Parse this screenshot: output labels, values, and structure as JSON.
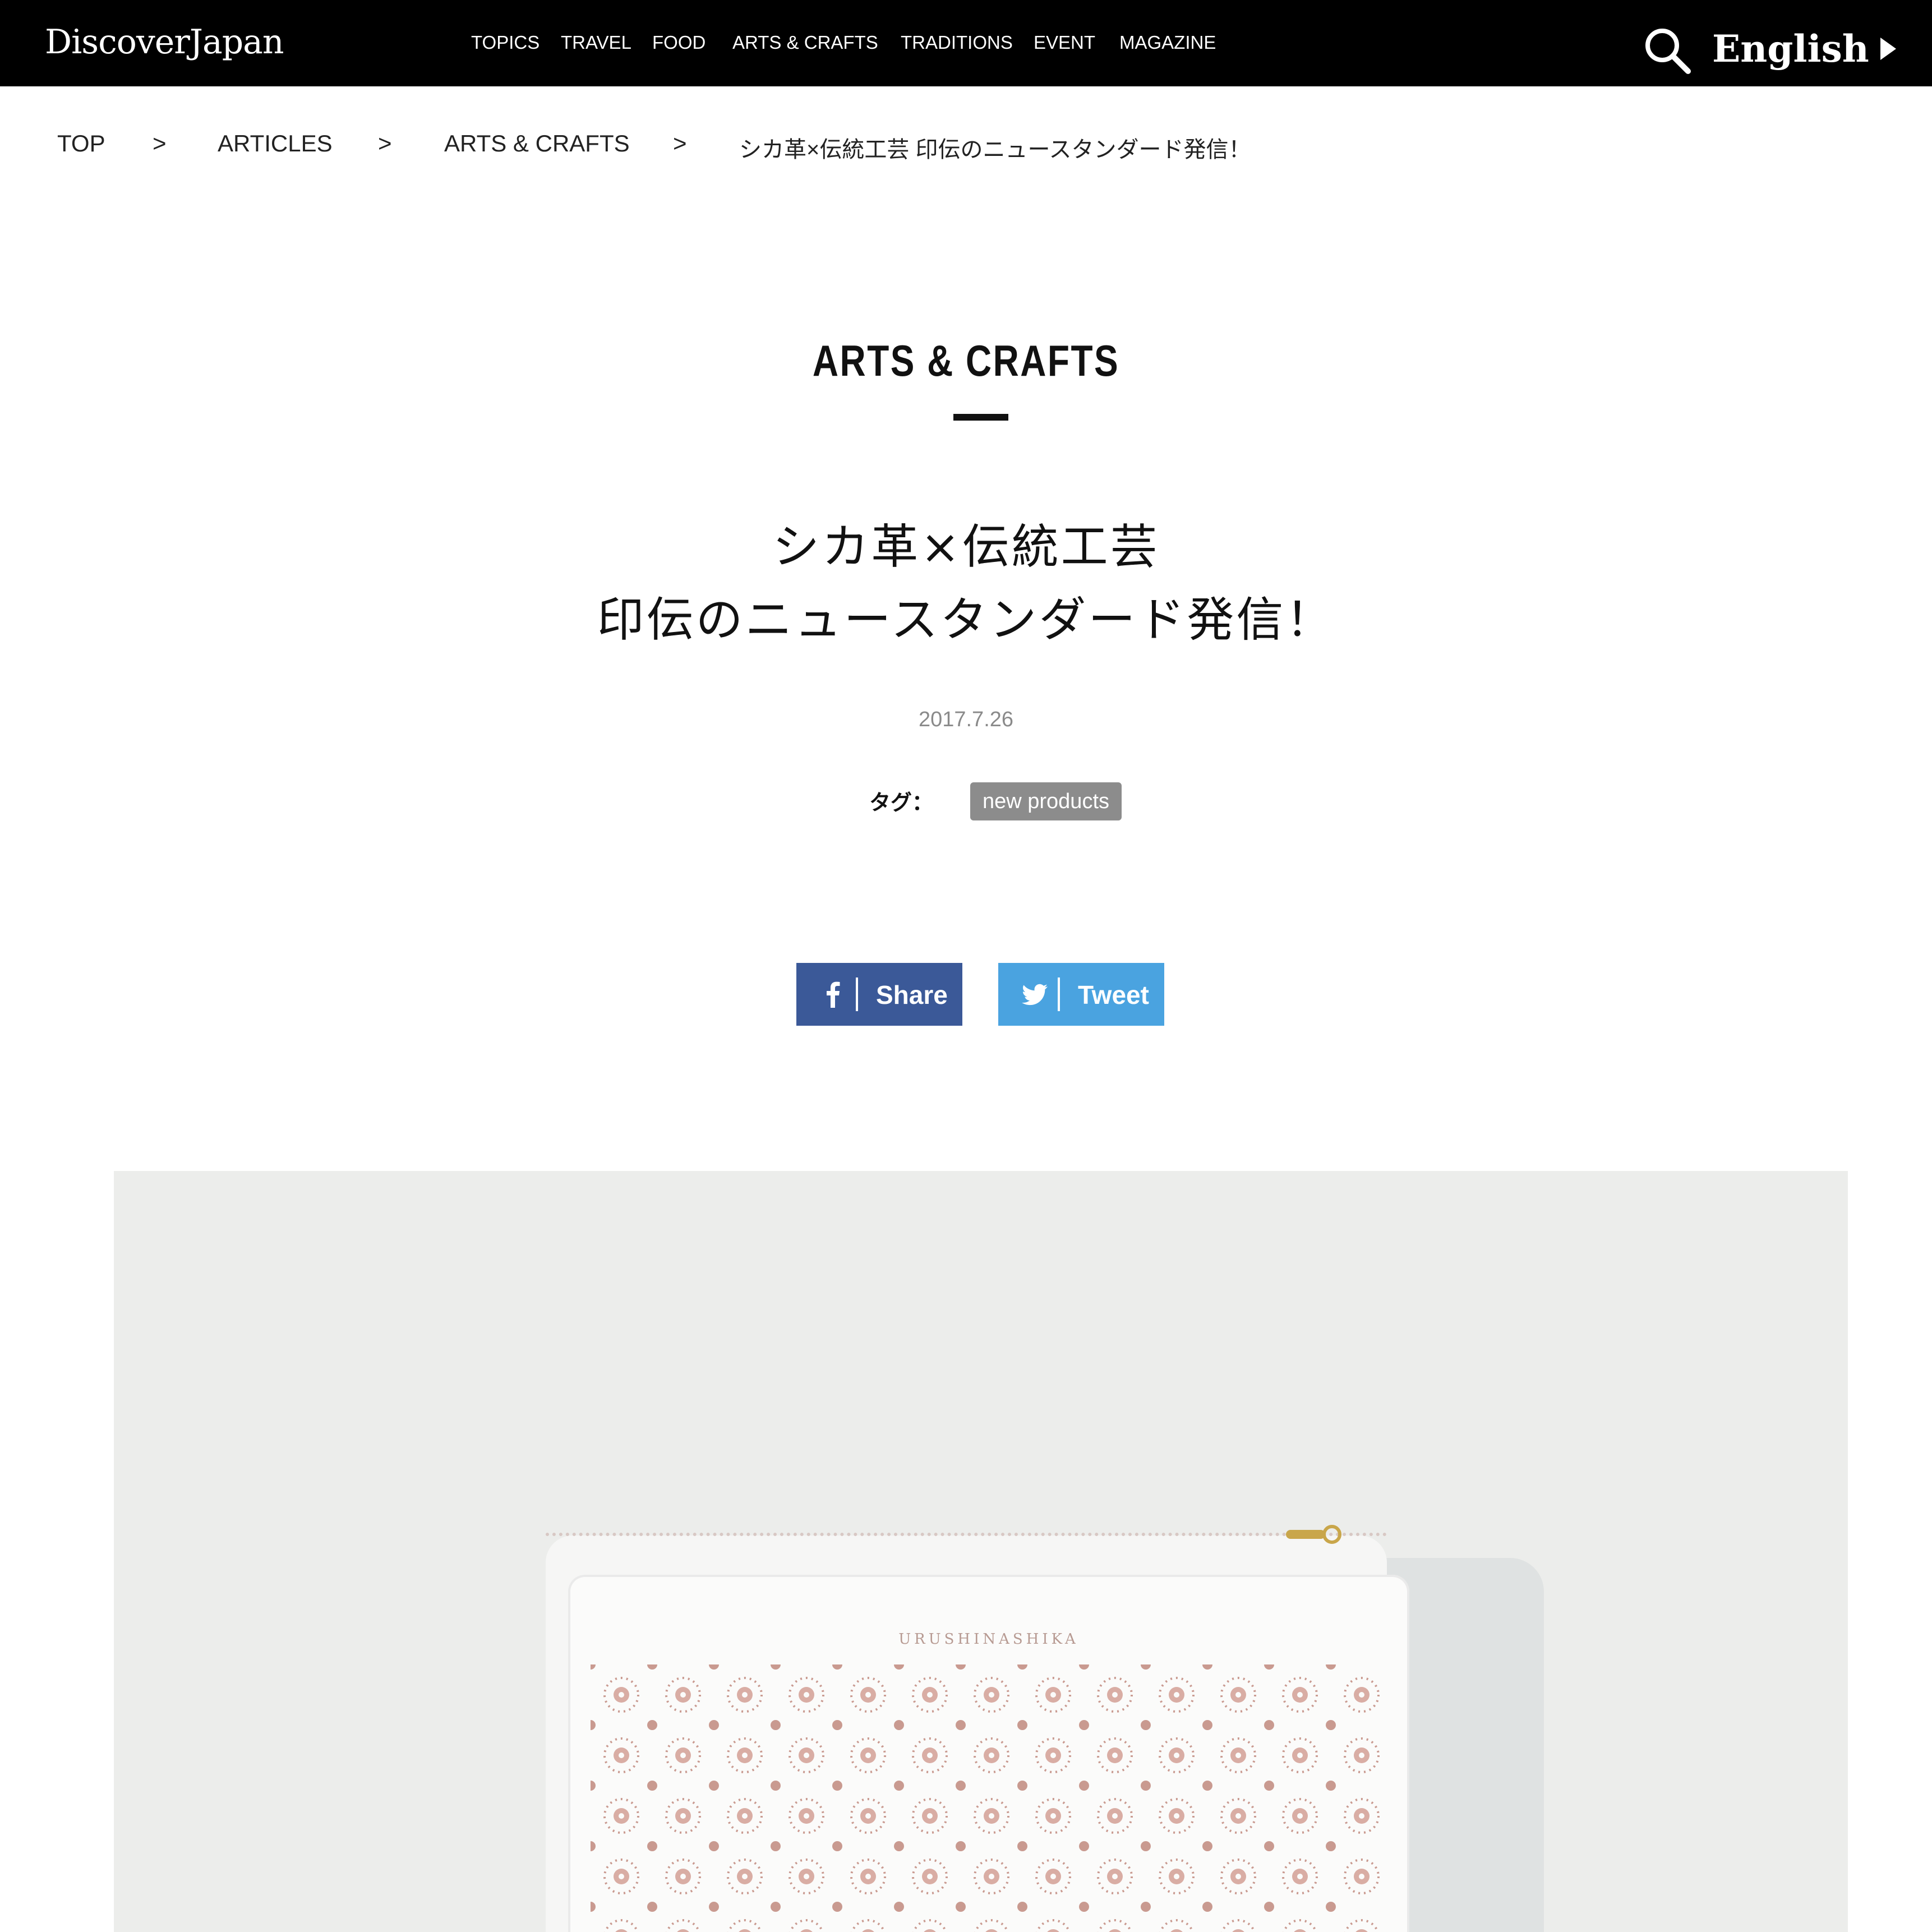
{
  "header": {
    "logo": "DiscoverJapan",
    "nav": [
      "TOPICS",
      "TRAVEL",
      "FOOD",
      "ARTS & CRAFTS",
      "TRADITIONS",
      "EVENT",
      "MAGAZINE"
    ],
    "language": "English",
    "search_icon": "search-icon"
  },
  "breadcrumb": {
    "items": [
      "TOP",
      "ARTICLES",
      "ARTS & CRAFTS",
      "シカ革×伝統工芸 印伝のニュースタンダード発信！"
    ],
    "separator": ">"
  },
  "article": {
    "category": "ARTS & CRAFTS",
    "title_line1": "シカ革×伝統工芸",
    "title_line2": "印伝のニュースタンダード発信！",
    "date": "2017.7.26",
    "tag_label": "タグ：",
    "tags": [
      "new products"
    ]
  },
  "share": {
    "facebook_label": "Share",
    "twitter_label": "Tweet",
    "facebook_color": "#3b5998",
    "twitter_color": "#4aa3e0"
  },
  "hero": {
    "brand_mark": "URUSHINASHIKA",
    "background": "#ecedeb",
    "pattern_color": "#c99a90"
  }
}
